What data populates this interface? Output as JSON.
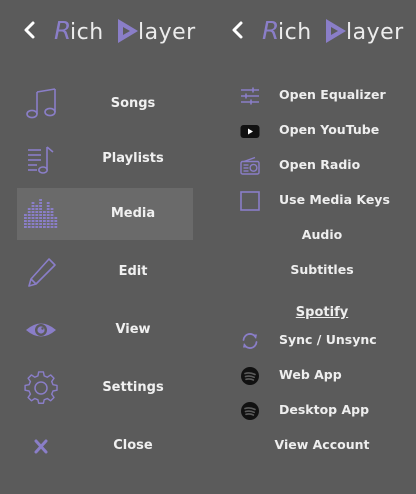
{
  "left_panel": {
    "header": {
      "back_icon": "chevron-left-icon",
      "logo_text": "Rich Player"
    },
    "menu": [
      {
        "label": "Songs",
        "icon": "music-note-icon",
        "active": false
      },
      {
        "label": "Playlists",
        "icon": "playlist-icon",
        "active": false
      },
      {
        "label": "Media",
        "icon": "equalizer-bars-icon",
        "active": true
      },
      {
        "label": "Edit",
        "icon": "pencil-icon",
        "active": false
      },
      {
        "label": "View",
        "icon": "eye-icon",
        "active": false
      },
      {
        "label": "Settings",
        "icon": "gear-icon",
        "active": false
      },
      {
        "label": "Close",
        "icon": "close-x-icon",
        "active": false
      }
    ]
  },
  "right_panel": {
    "header": {
      "back_icon": "chevron-left-icon",
      "logo_text": "Rich Player"
    },
    "items": [
      {
        "label": "Open Equalizer",
        "icon": "sliders-icon"
      },
      {
        "label": "Open YouTube",
        "icon": "youtube-icon"
      },
      {
        "label": "Open Radio",
        "icon": "radio-icon"
      },
      {
        "label": "Use Media Keys",
        "icon": "checkbox-icon",
        "checked": false
      },
      {
        "label": "Audio"
      },
      {
        "label": "Subtitles"
      }
    ],
    "spotify": {
      "heading": "Spotify",
      "items": [
        {
          "label": "Sync / Unsync",
          "icon": "sync-icon"
        },
        {
          "label": "Web App",
          "icon": "spotify-icon"
        },
        {
          "label": "Desktop App",
          "icon": "spotify-icon"
        },
        {
          "label": "View Account"
        }
      ]
    }
  },
  "colors": {
    "background": "#5b5b5b",
    "accent": "#8a7ec8",
    "active_item": "#6a6a6a",
    "text": "#eeeeee"
  }
}
